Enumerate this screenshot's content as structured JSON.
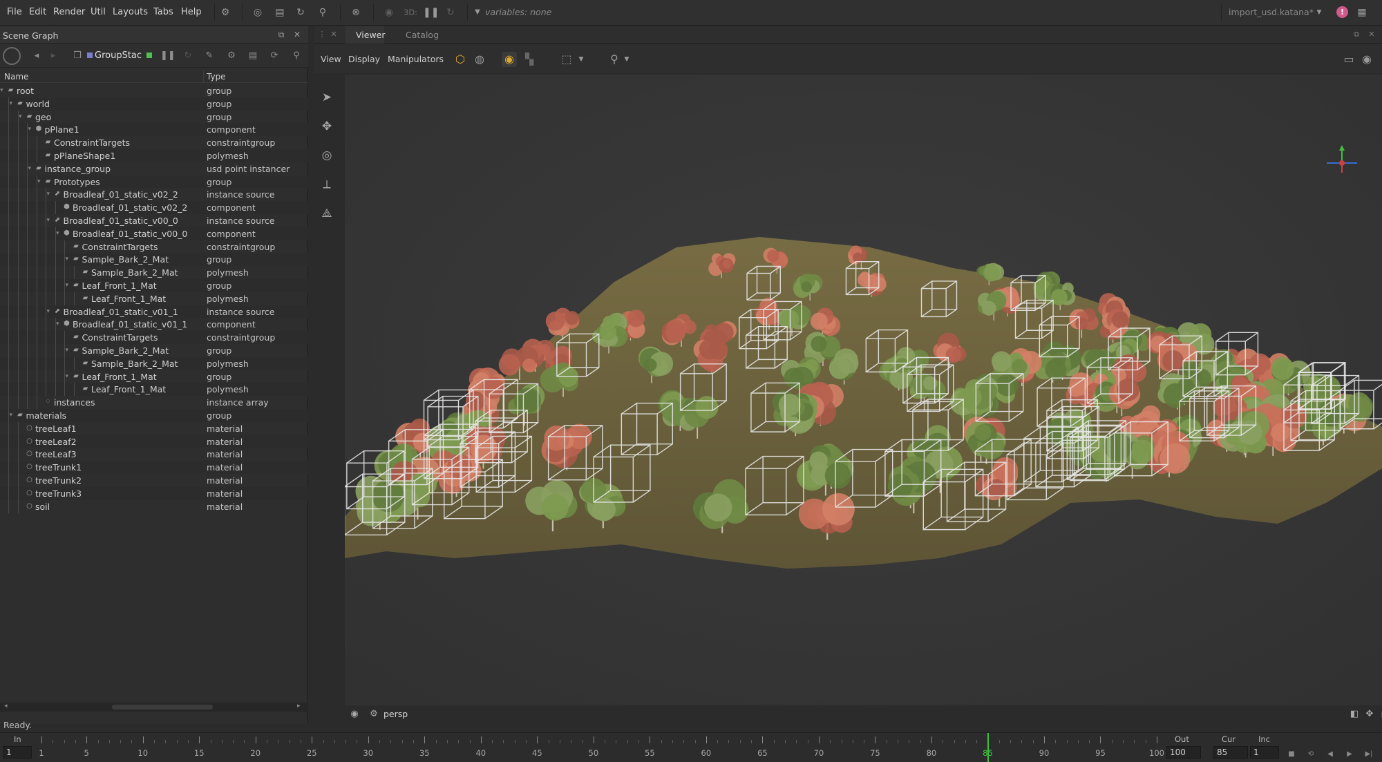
{
  "menubar": {
    "menus": [
      "File",
      "Edit",
      "Render",
      "Util",
      "Layouts",
      "Tabs",
      "Help"
    ],
    "mode_label": "3D:",
    "variables": "variables: none",
    "project": "import_usd.katana",
    "project_dirty": "*",
    "alert": "!"
  },
  "scene_graph": {
    "title": "Scene Graph",
    "node": "GroupStac",
    "columns": {
      "name": "Name",
      "type": "Type"
    },
    "rows": [
      {
        "name": "root",
        "type": "group",
        "depth": 0,
        "icon": "group"
      },
      {
        "name": "world",
        "type": "group",
        "depth": 1,
        "icon": "group"
      },
      {
        "name": "geo",
        "type": "group",
        "depth": 2,
        "icon": "group"
      },
      {
        "name": "pPlane1",
        "type": "component",
        "depth": 3,
        "icon": "component"
      },
      {
        "name": "ConstraintTargets",
        "type": "constraintgroup",
        "depth": 4,
        "icon": "group"
      },
      {
        "name": "pPlaneShape1",
        "type": "polymesh",
        "depth": 4,
        "icon": "polymesh"
      },
      {
        "name": "instance_group",
        "type": "usd point instancer",
        "depth": 3,
        "icon": "group"
      },
      {
        "name": "Prototypes",
        "type": "group",
        "depth": 4,
        "icon": "group"
      },
      {
        "name": "Broadleaf_01_static_v02_2",
        "type": "instance source",
        "depth": 5,
        "icon": "source"
      },
      {
        "name": "Broadleaf_01_static_v02_2",
        "type": "component",
        "depth": 6,
        "icon": "component"
      },
      {
        "name": "Broadleaf_01_static_v00_0",
        "type": "instance source",
        "depth": 5,
        "icon": "source"
      },
      {
        "name": "Broadleaf_01_static_v00_0",
        "type": "component",
        "depth": 6,
        "icon": "component"
      },
      {
        "name": "ConstraintTargets",
        "type": "constraintgroup",
        "depth": 7,
        "icon": "group"
      },
      {
        "name": "Sample_Bark_2_Mat",
        "type": "group",
        "depth": 7,
        "icon": "group"
      },
      {
        "name": "Sample_Bark_2_Mat",
        "type": "polymesh",
        "depth": 8,
        "icon": "polymesh"
      },
      {
        "name": "Leaf_Front_1_Mat",
        "type": "group",
        "depth": 7,
        "icon": "group"
      },
      {
        "name": "Leaf_Front_1_Mat",
        "type": "polymesh",
        "depth": 8,
        "icon": "polymesh"
      },
      {
        "name": "Broadleaf_01_static_v01_1",
        "type": "instance source",
        "depth": 5,
        "icon": "source"
      },
      {
        "name": "Broadleaf_01_static_v01_1",
        "type": "component",
        "depth": 6,
        "icon": "component"
      },
      {
        "name": "ConstraintTargets",
        "type": "constraintgroup",
        "depth": 7,
        "icon": "group"
      },
      {
        "name": "Sample_Bark_2_Mat",
        "type": "group",
        "depth": 7,
        "icon": "group"
      },
      {
        "name": "Sample_Bark_2_Mat",
        "type": "polymesh",
        "depth": 8,
        "icon": "polymesh"
      },
      {
        "name": "Leaf_Front_1_Mat",
        "type": "group",
        "depth": 7,
        "icon": "group"
      },
      {
        "name": "Leaf_Front_1_Mat",
        "type": "polymesh",
        "depth": 8,
        "icon": "polymesh"
      },
      {
        "name": "instances",
        "type": "instance array",
        "depth": 4,
        "icon": "array"
      },
      {
        "name": "materials",
        "type": "group",
        "depth": 1,
        "icon": "group"
      },
      {
        "name": "treeLeaf1",
        "type": "material",
        "depth": 2,
        "icon": "material"
      },
      {
        "name": "treeLeaf2",
        "type": "material",
        "depth": 2,
        "icon": "material"
      },
      {
        "name": "treeLeaf3",
        "type": "material",
        "depth": 2,
        "icon": "material"
      },
      {
        "name": "treeTrunk1",
        "type": "material",
        "depth": 2,
        "icon": "material"
      },
      {
        "name": "treeTrunk2",
        "type": "material",
        "depth": 2,
        "icon": "material"
      },
      {
        "name": "treeTrunk3",
        "type": "material",
        "depth": 2,
        "icon": "material"
      },
      {
        "name": "soil",
        "type": "material",
        "depth": 2,
        "icon": "material"
      }
    ]
  },
  "status": "Ready.",
  "viewer": {
    "tabs": [
      "Viewer",
      "Catalog"
    ],
    "menus": [
      "View",
      "Display",
      "Manipulators"
    ],
    "camera": "persp"
  },
  "timeline": {
    "in_label": "In",
    "in_value": "1",
    "out_label": "Out",
    "out_value": "100",
    "cur_label": "Cur",
    "cur_value": "85",
    "inc_label": "Inc",
    "inc_value": "1",
    "tick_labels": [
      "1",
      "5",
      "10",
      "15",
      "20",
      "25",
      "30",
      "35",
      "40",
      "45",
      "50",
      "55",
      "60",
      "65",
      "70",
      "75",
      "80",
      "85",
      "90",
      "95",
      "100"
    ],
    "range": [
      1,
      100
    ],
    "current_frame": 85
  },
  "colors": {
    "accent_green": "#40c040",
    "cube_orange": "#e0a830",
    "terrain": "#6e6440",
    "tree_orange": "#c8705a",
    "tree_green": "#6f8a45",
    "wire": "#e8e8e8"
  }
}
